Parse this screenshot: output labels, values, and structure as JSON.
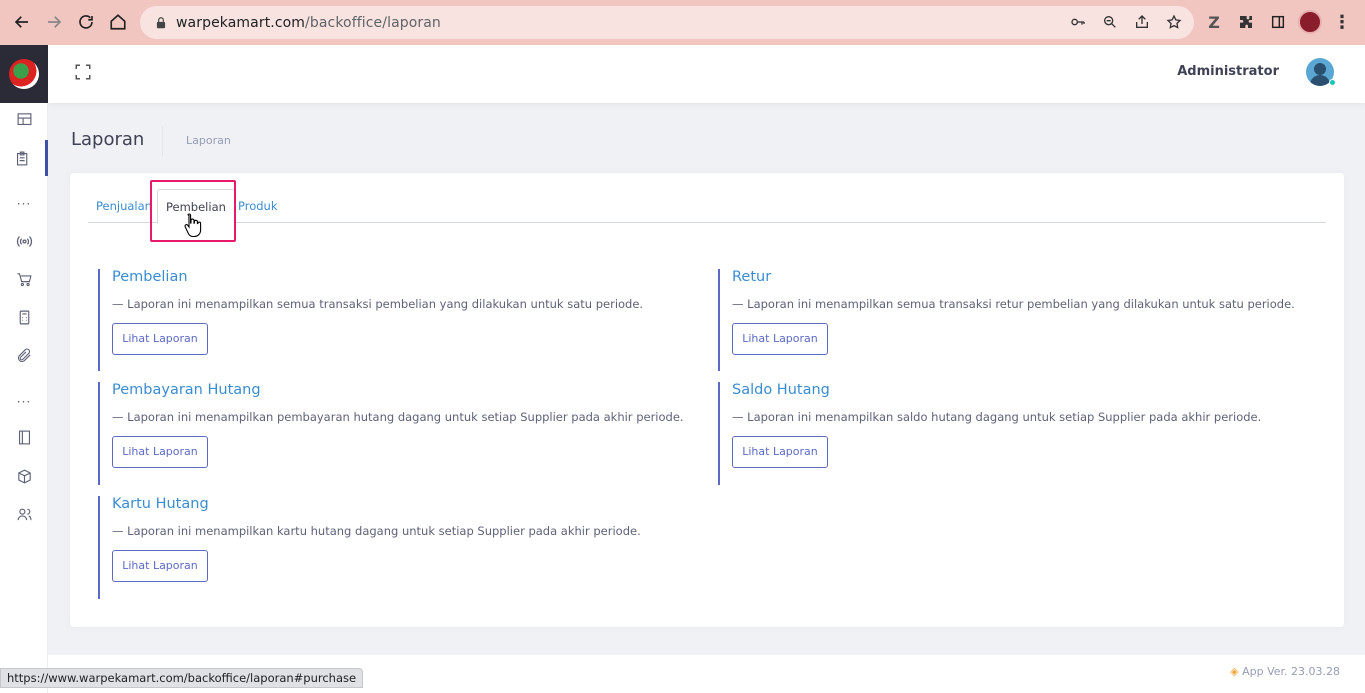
{
  "browser": {
    "url_host": "warpekamart.com",
    "url_path": "/backoffice/laporan",
    "status_url": "https://www.warpekamart.com/backoffice/laporan#purchase"
  },
  "header": {
    "admin_name": "Administrator"
  },
  "page": {
    "title": "Laporan",
    "breadcrumb": "Laporan"
  },
  "tabs": [
    {
      "label": "Penjualan",
      "active": false
    },
    {
      "label": "Pembelian",
      "active": true
    },
    {
      "label": "Produk",
      "active": false
    }
  ],
  "reports": [
    {
      "title": "Pembelian",
      "desc": "— Laporan ini menampilkan semua transaksi pembelian yang dilakukan untuk satu periode.",
      "button": "Lihat Laporan"
    },
    {
      "title": "Retur",
      "desc": "— Laporan ini menampilkan semua transaksi retur pembelian yang dilakukan untuk satu periode.",
      "button": "Lihat Laporan"
    },
    {
      "title": "Pembayaran Hutang",
      "desc": "— Laporan ini menampilkan pembayaran hutang dagang untuk setiap Supplier pada akhir periode.",
      "button": "Lihat Laporan"
    },
    {
      "title": "Saldo Hutang",
      "desc": "— Laporan ini menampilkan saldo hutang dagang untuk setiap Supplier pada akhir periode.",
      "button": "Lihat Laporan"
    },
    {
      "title": "Kartu Hutang",
      "desc": "— Laporan ini menampilkan kartu hutang dagang untuk setiap Supplier pada akhir periode.",
      "button": "Lihat Laporan"
    }
  ],
  "footer": {
    "version": "App Ver. 23.03.28"
  },
  "colors": {
    "accent": "#3a8dd0",
    "button_border": "#5c6ac4",
    "highlight": "#e8196b",
    "browser_bar": "#f2c6c0"
  },
  "icons": {
    "sidebar": [
      "dashboard-icon",
      "clipboard-icon",
      "broadcast-icon",
      "cart-icon",
      "calculator-icon",
      "paperclip-icon",
      "book-icon",
      "box-icon",
      "users-icon"
    ]
  }
}
